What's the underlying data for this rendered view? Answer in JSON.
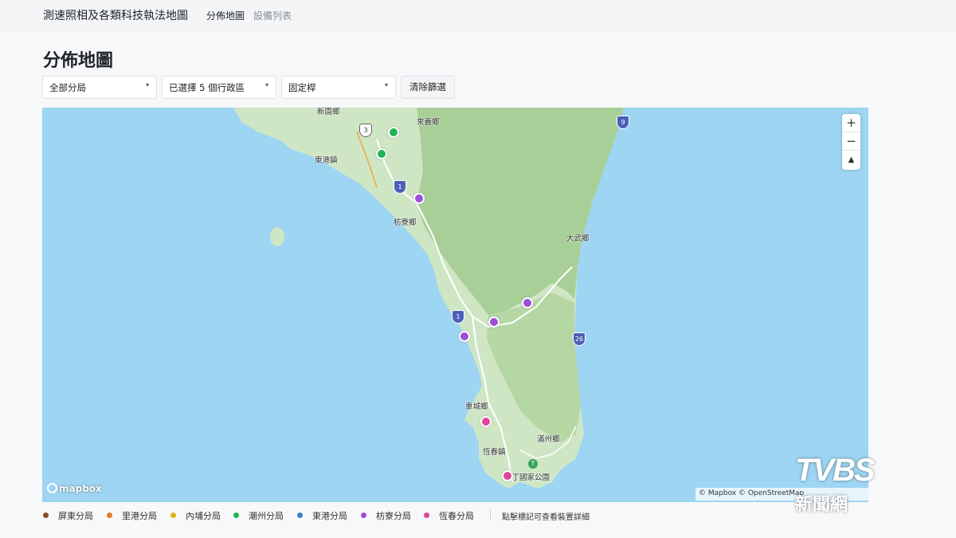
{
  "app": {
    "title": "測速照相及各類科技執法地圖",
    "nav": [
      "分佈地圖",
      "設備列表"
    ]
  },
  "page": {
    "title": "分佈地圖"
  },
  "filters": {
    "branch": "全部分局",
    "districts": "已選擇 5 個行政區",
    "device_type": "固定桿",
    "clear_label": "清除篩選"
  },
  "map": {
    "places": [
      "新園鄉",
      "來義鄉",
      "東港鎮",
      "枋寮鄉",
      "大武鄉",
      "車城鄉",
      "滿州鄉",
      "恆春鎮",
      "墾丁國家公園"
    ],
    "highway_shields": [
      "1",
      "1",
      "9",
      "26",
      "3"
    ],
    "controls": {
      "zoom_in": "+",
      "zoom_out": "−",
      "compass": "▲"
    },
    "logo": "mapbox",
    "attribution": "© Mapbox © OpenStreetMap"
  },
  "legend": [
    {
      "label": "屏東分局",
      "color": "#8b4a2b"
    },
    {
      "label": "里港分局",
      "color": "#e07a2e"
    },
    {
      "label": "內埔分局",
      "color": "#e0b020"
    },
    {
      "label": "潮州分局",
      "color": "#22b455"
    },
    {
      "label": "東港分局",
      "color": "#3d7ecf"
    },
    {
      "label": "枋寮分局",
      "color": "#9b4fd8"
    },
    {
      "label": "恆春分局",
      "color": "#e0459a"
    }
  ],
  "legend_hint": "點擊標記可查看裝置詳細",
  "watermark": {
    "logo": "TVBS",
    "sub": "新聞網"
  }
}
